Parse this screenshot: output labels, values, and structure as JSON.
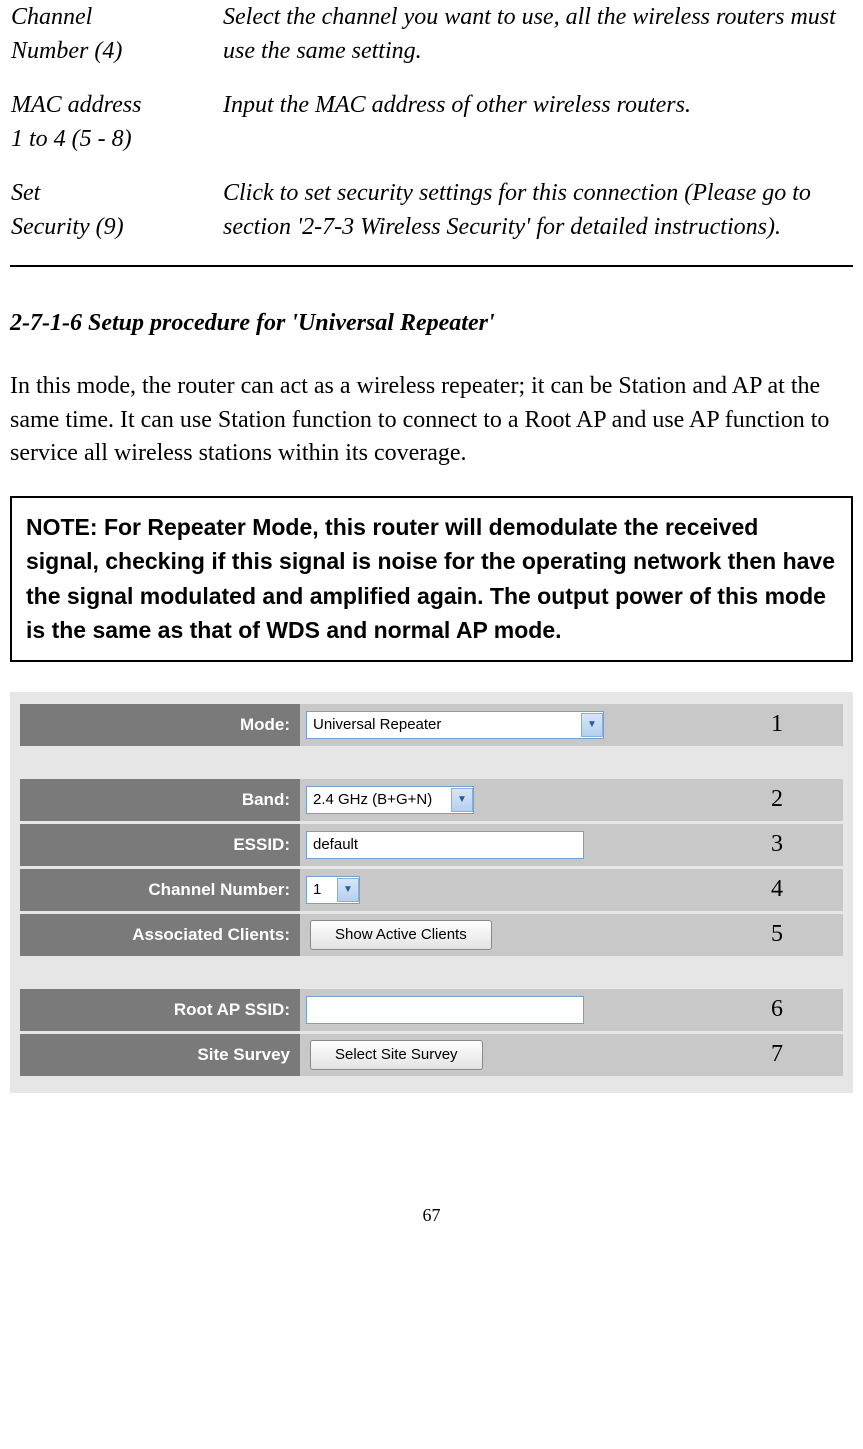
{
  "definitions": [
    {
      "term1": "Channel",
      "term2": "Number (4)",
      "desc": "Select the channel you want to use, all the wireless routers must use the same setting."
    },
    {
      "term1": "MAC address",
      "term2": "1 to 4 (5 - 8)",
      "desc": "Input the MAC address of other wireless routers."
    },
    {
      "term1": "Set",
      "term2": "Security (9)",
      "desc": "Click to set security settings for this connection (Please go to section '2-7-3 Wireless Security' for detailed instructions)."
    }
  ],
  "section_heading": "2-7-1-6 Setup procedure for 'Universal Repeater'",
  "body_text": "In this mode, the router can act as a wireless repeater; it can be Station and AP at the same time. It can use Station function to connect to a Root AP and use AP function to service all wireless stations within its coverage.",
  "note_text": "NOTE: For Repeater Mode, this router will demodulate the received signal, checking if this signal is noise for the operating network then have the signal modulated and amplified again. The output power of this mode is the same as that of WDS and normal AP mode.",
  "form": {
    "mode_label": "Mode:",
    "mode_value": "Universal Repeater",
    "band_label": "Band:",
    "band_value": "2.4 GHz (B+G+N)",
    "essid_label": "ESSID:",
    "essid_value": "default",
    "channel_label": "Channel Number:",
    "channel_value": "1",
    "clients_label": "Associated Clients:",
    "clients_button": "Show Active Clients",
    "root_label": "Root AP SSID:",
    "root_value": "",
    "survey_label": "Site Survey",
    "survey_button": "Select Site Survey"
  },
  "annotations": {
    "a1": "1",
    "a2": "2",
    "a3": "3",
    "a4": "4",
    "a5": "5",
    "a6": "6",
    "a7": "7"
  },
  "page_number": "67"
}
